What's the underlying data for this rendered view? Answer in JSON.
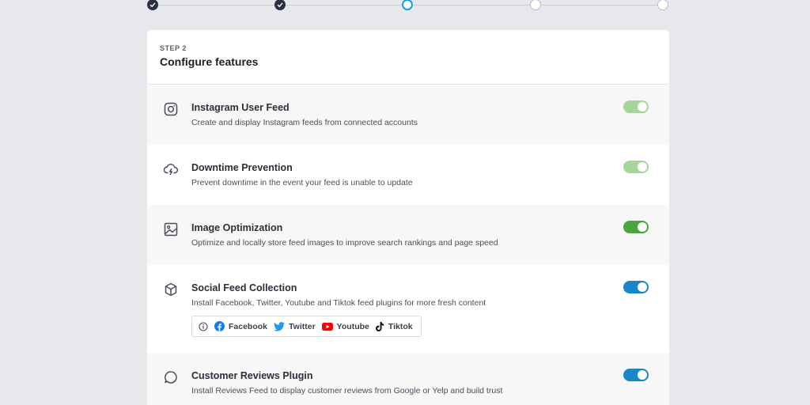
{
  "stepper": {
    "steps": [
      {
        "state": "done"
      },
      {
        "state": "done"
      },
      {
        "state": "current"
      },
      {
        "state": "todo"
      },
      {
        "state": "todo"
      }
    ],
    "colors": {
      "done": "#2b2f45",
      "current": "#1a9ed8",
      "todo": "#b9b9c2"
    }
  },
  "card": {
    "step_label": "STEP 2",
    "title": "Configure features"
  },
  "features": [
    {
      "icon": "instagram-icon",
      "title": "Instagram User Feed",
      "description": "Create and display Instagram feeds from connected accounts",
      "toggle": "on",
      "toggle_color": "#a6d49a"
    },
    {
      "icon": "cloud-lightning-icon",
      "title": "Downtime Prevention",
      "description": "Prevent downtime in the event your feed is unable to update",
      "toggle": "on",
      "toggle_color": "#a6d49a"
    },
    {
      "icon": "image-icon",
      "title": "Image Optimization",
      "description": "Optimize and locally store feed images to improve search rankings and page speed",
      "toggle": "on",
      "toggle_color": "#4aa53f"
    },
    {
      "icon": "cube-icon",
      "title": "Social Feed Collection",
      "description": "Install Facebook, Twitter, Youtube and Tiktok feed plugins for more fresh content",
      "toggle": "on",
      "toggle_color": "#1787c8",
      "plugins": [
        {
          "icon": "facebook-icon",
          "label": "Facebook"
        },
        {
          "icon": "twitter-icon",
          "label": "Twitter"
        },
        {
          "icon": "youtube-icon",
          "label": "Youtube"
        },
        {
          "icon": "tiktok-icon",
          "label": "Tiktok"
        }
      ]
    },
    {
      "icon": "chat-bubble-icon",
      "title": "Customer Reviews Plugin",
      "description": "Install Reviews Feed to display customer reviews from Google or Yelp and build trust",
      "toggle": "on",
      "toggle_color": "#1787c8"
    }
  ]
}
